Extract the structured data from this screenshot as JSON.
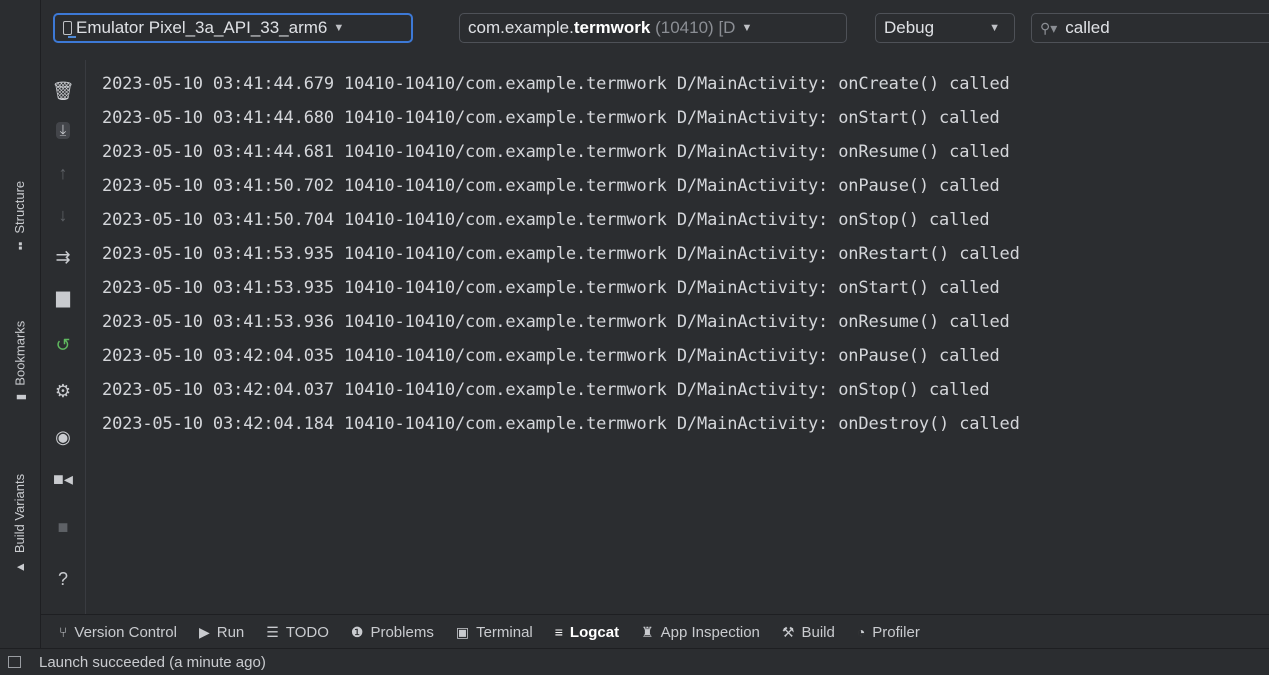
{
  "toolbar": {
    "device": "Emulator Pixel_3a_API_33_arm6",
    "process_prefix": "com.example.",
    "process_bold": "termwork",
    "process_pid": "(10410)",
    "process_suffix": "[D",
    "log_level": "Debug",
    "search_value": "called"
  },
  "left_strip": {
    "structure": "Structure",
    "bookmarks": "Bookmarks",
    "build_variants": "Build Variants"
  },
  "log_tools": {
    "help": "?"
  },
  "log_lines": [
    "2023-05-10 03:41:44.679 10410-10410/com.example.termwork D/MainActivity: onCreate() called",
    "2023-05-10 03:41:44.680 10410-10410/com.example.termwork D/MainActivity: onStart() called",
    "2023-05-10 03:41:44.681 10410-10410/com.example.termwork D/MainActivity: onResume() called",
    "2023-05-10 03:41:50.702 10410-10410/com.example.termwork D/MainActivity: onPause() called",
    "2023-05-10 03:41:50.704 10410-10410/com.example.termwork D/MainActivity: onStop() called",
    "2023-05-10 03:41:53.935 10410-10410/com.example.termwork D/MainActivity: onRestart() called",
    "2023-05-10 03:41:53.935 10410-10410/com.example.termwork D/MainActivity: onStart() called",
    "2023-05-10 03:41:53.936 10410-10410/com.example.termwork D/MainActivity: onResume() called",
    "2023-05-10 03:42:04.035 10410-10410/com.example.termwork D/MainActivity: onPause() called",
    "2023-05-10 03:42:04.037 10410-10410/com.example.termwork D/MainActivity: onStop() called",
    "2023-05-10 03:42:04.184 10410-10410/com.example.termwork D/MainActivity: onDestroy() called"
  ],
  "bottom_tabs": {
    "version_control": "Version Control",
    "run": "Run",
    "todo": "TODO",
    "problems": "Problems",
    "terminal": "Terminal",
    "logcat": "Logcat",
    "app_inspection": "App Inspection",
    "build": "Build",
    "profiler": "Profiler"
  },
  "status": {
    "message": "Launch succeeded (a minute ago)"
  }
}
